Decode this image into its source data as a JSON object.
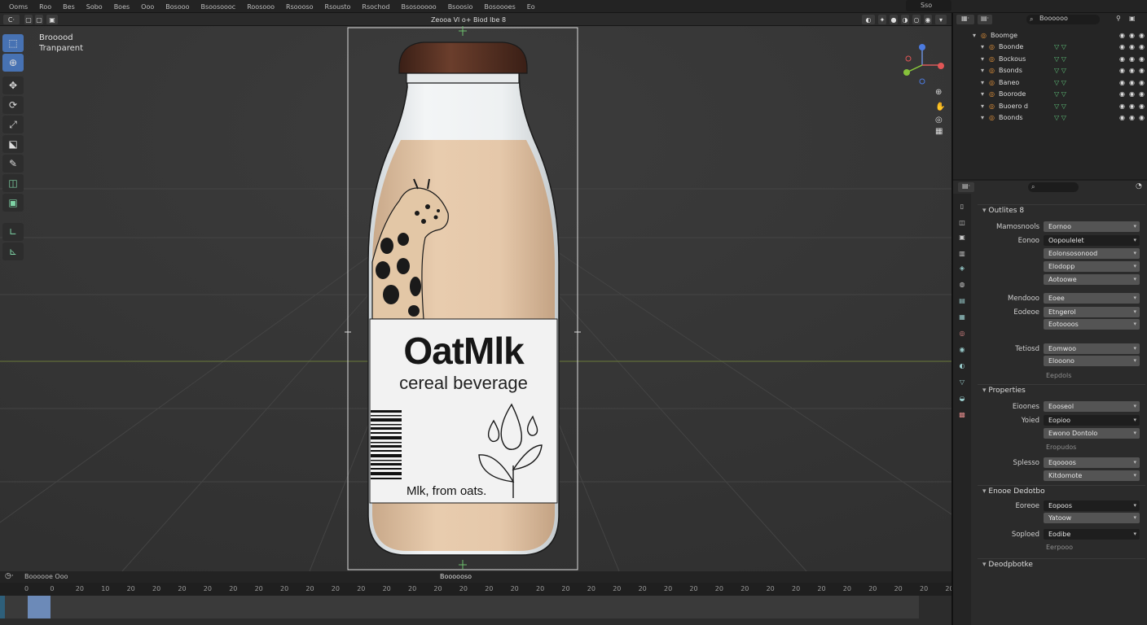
{
  "menu": [
    "Ooms",
    "Roo",
    "Bes",
    "Sobo",
    "Boes",
    "Ooo",
    "Bosooo",
    "Bsoosoooc",
    "Roosooo",
    "Rsoooso",
    "Rsousto",
    "Rsochod",
    "Bsosooooo",
    "Bsoosio",
    "Bosoooes",
    "Eo"
  ],
  "header": {
    "title": "Zeooa  Vl o+  Biod lbe 8"
  },
  "overlay": {
    "line1": "Brooood",
    "line2": "Tranparent"
  },
  "bottle": {
    "brand": "OatMlk",
    "subtitle": "cereal beverage",
    "tagline": "Mlk, from oats."
  },
  "outliner": {
    "search_placeholder": "Boooooo",
    "search2": "Sso",
    "items": [
      {
        "label": "Boomge",
        "indent": 0
      },
      {
        "label": "Boonde",
        "indent": 1
      },
      {
        "label": "Bockous",
        "indent": 1
      },
      {
        "label": "Bsonds",
        "indent": 1
      },
      {
        "label": "Baneo",
        "indent": 1
      },
      {
        "label": "Boorode",
        "indent": 1
      },
      {
        "label": "Buoero d",
        "indent": 1
      },
      {
        "label": "Boonds",
        "indent": 1
      }
    ]
  },
  "properties": {
    "section1": "Outlites 8",
    "rows1": [
      {
        "label": "Mamosnools",
        "value": "Eornoo",
        "dark": false
      },
      {
        "label": "Eonoo",
        "value": "Oopoulelet",
        "dark": true
      },
      {
        "label": "",
        "value": "Eolonsosonood",
        "dark": false
      },
      {
        "label": "",
        "value": "Elodopp",
        "dark": false
      },
      {
        "label": "",
        "value": "Aotoowe",
        "dark": false
      },
      {
        "label": "Mendooo",
        "value": "Eoee",
        "dark": false
      },
      {
        "label": "Eodeoe",
        "value": "Etngerol",
        "dark": false
      },
      {
        "label": "",
        "value": "Eotoooos",
        "dark": false
      },
      {
        "label": "Tetiosd",
        "value": "Eomwoo",
        "dark": false
      },
      {
        "label": "",
        "value": "Elooono",
        "dark": false
      }
    ],
    "note1": "Eepdols",
    "section2": "Properties",
    "rows2": [
      {
        "label": "Eioones",
        "value": "Eooseol",
        "dark": false
      },
      {
        "label": "Yoied",
        "value": "Eopioo",
        "dark": true
      },
      {
        "label": "",
        "value": "Ewono Dontolo",
        "dark": false
      }
    ],
    "note2": "Eropudos",
    "rows3": [
      {
        "label": "Splesso",
        "value": "Eqoooos",
        "dark": false
      },
      {
        "label": "",
        "value": "Kitdomote",
        "dark": false
      }
    ],
    "section3": "Enooe Dedotbo",
    "rows4": [
      {
        "label": "Eoreoe",
        "value": "Eopoos",
        "dark": true
      },
      {
        "label": "",
        "value": "Yatoow",
        "dark": false
      },
      {
        "label": "Soploed",
        "value": "Eodibe",
        "dark": true
      }
    ],
    "note3": "Eerpooo",
    "section4": "Deodpbotke"
  },
  "timeline": {
    "label": "Boooooe  Ooo",
    "frame_label": "Boooooso",
    "ticks": [
      "0",
      "0",
      "20",
      "10",
      "20",
      "20",
      "20",
      "20",
      "20",
      "20",
      "20",
      "20",
      "20",
      "20",
      "20",
      "20",
      "20",
      "20",
      "20",
      "20",
      "20",
      "20",
      "20",
      "20",
      "20",
      "20",
      "20",
      "20",
      "20",
      "20",
      "20",
      "20",
      "20",
      "20",
      "20",
      "20",
      "20"
    ]
  },
  "colors": {
    "accent": "#4772b3",
    "milk": "#e2c4a6",
    "cap": "#4a2a1f"
  }
}
